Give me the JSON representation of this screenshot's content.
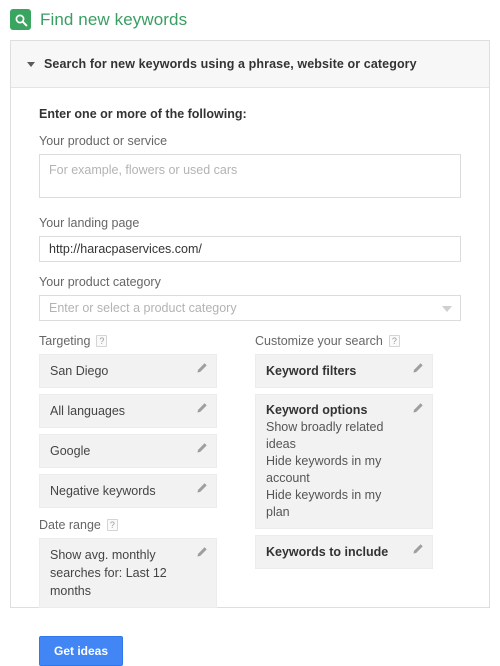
{
  "header": {
    "icon": "search-icon",
    "title": "Find new keywords",
    "title_color": "#3a9e63",
    "icon_bg": "#39a561"
  },
  "panel": {
    "collapse_icon": "chevron-down-icon",
    "header_label": "Search for new keywords using a phrase, website or category",
    "intro": "Enter one or more of the following:",
    "fields": {
      "product_or_service": {
        "label": "Your product or service",
        "placeholder": "For example, flowers or used cars",
        "value": ""
      },
      "landing_page": {
        "label": "Your landing page",
        "placeholder": "",
        "value": "http://haracpaservices.com/"
      },
      "product_category": {
        "label": "Your product category",
        "placeholder": "Enter or select a product category",
        "value": "",
        "dropdown_icon": "chevron-down-icon"
      }
    },
    "targeting": {
      "label": "Targeting",
      "help": "?",
      "items": [
        {
          "text": "San Diego",
          "edit_icon": "pencil-icon"
        },
        {
          "text": "All languages",
          "edit_icon": "pencil-icon"
        },
        {
          "text": "Google",
          "edit_icon": "pencil-icon"
        },
        {
          "text": "Negative keywords",
          "edit_icon": "pencil-icon"
        }
      ]
    },
    "date_range": {
      "label": "Date range",
      "help": "?",
      "value": "Show avg. monthly searches for: Last 12 months",
      "edit_icon": "pencil-icon"
    },
    "customize": {
      "label": "Customize your search",
      "help": "?",
      "keyword_filters": {
        "title": "Keyword filters",
        "edit_icon": "pencil-icon"
      },
      "keyword_options": {
        "title": "Keyword options",
        "edit_icon": "pencil-icon",
        "options": [
          "Show broadly related ideas",
          "Hide keywords in my account",
          "Hide keywords in my plan"
        ]
      },
      "keywords_to_include": {
        "title": "Keywords to include",
        "edit_icon": "pencil-icon"
      }
    },
    "submit": {
      "label": "Get ideas",
      "color": "#4285f4"
    }
  }
}
